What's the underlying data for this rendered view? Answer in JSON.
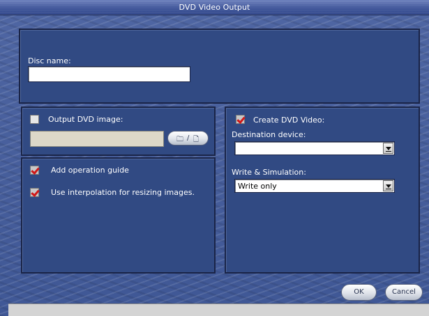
{
  "window": {
    "title": "DVD Video Output"
  },
  "disc": {
    "name_label": "Disc name:",
    "name_value": ""
  },
  "image_output": {
    "checkbox_label": "Output DVD image:",
    "checked": false,
    "path_value": "",
    "browse_icon_left": "🗀",
    "browse_icon_sep": "/",
    "browse_icon_right": "🗋"
  },
  "options": {
    "operation_guide_label": "Add operation guide",
    "operation_guide_checked": true,
    "interpolation_label": "Use interpolation for resizing images.",
    "interpolation_checked": true
  },
  "dvd_video": {
    "checkbox_label": "Create DVD Video:",
    "checked": true,
    "destination_label": "Destination device:",
    "destination_value": "",
    "write_label": "Write & Simulation:",
    "write_value": "Write only"
  },
  "buttons": {
    "ok": "OK",
    "cancel": "Cancel"
  }
}
